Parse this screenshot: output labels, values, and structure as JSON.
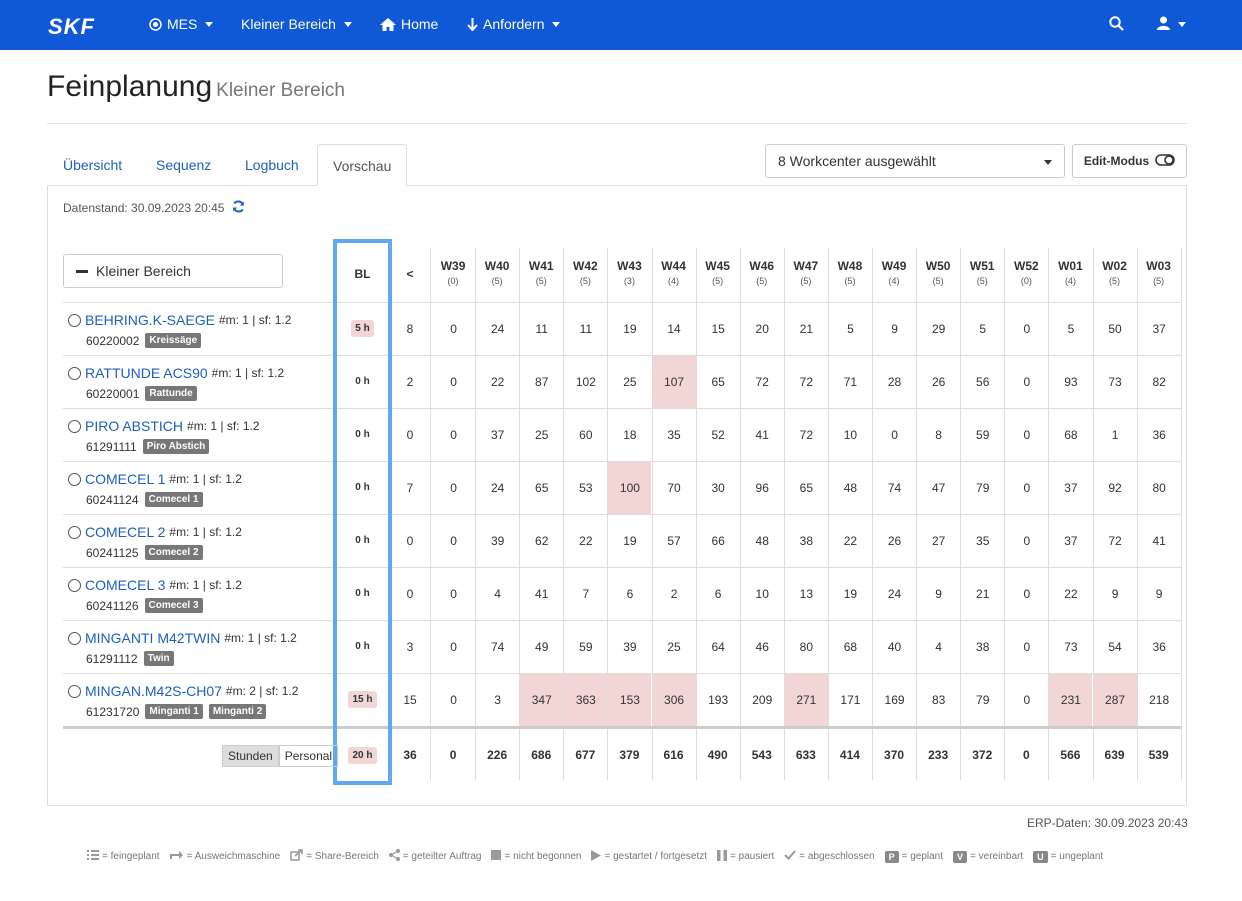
{
  "nav": {
    "logo": "SKF",
    "items": [
      {
        "label": "MES",
        "icon": "target-icon"
      },
      {
        "label": "Kleiner Bereich",
        "icon": ""
      },
      {
        "label": "Home",
        "icon": "home-icon"
      },
      {
        "label": "Anfordern",
        "icon": "arrow-down-icon"
      }
    ]
  },
  "page": {
    "title": "Feinplanung",
    "subtitle": "Kleiner Bereich"
  },
  "tabs": [
    "Übersicht",
    "Sequenz",
    "Logbuch",
    "Vorschau"
  ],
  "workcenter_select": "8 Workcenter ausgewählt",
  "edit_mode_label": "Edit-Modus",
  "datenstand": "Datenstand: 30.09.2023 20:45",
  "bereich_button": "Kleiner Bereich",
  "columns": {
    "bl": "BL",
    "lt": "<",
    "weeks": [
      {
        "w": "W39",
        "n": "(0)"
      },
      {
        "w": "W40",
        "n": "(5)"
      },
      {
        "w": "W41",
        "n": "(5)"
      },
      {
        "w": "W42",
        "n": "(5)"
      },
      {
        "w": "W43",
        "n": "(3)"
      },
      {
        "w": "W44",
        "n": "(4)"
      },
      {
        "w": "W45",
        "n": "(5)"
      },
      {
        "w": "W46",
        "n": "(5)"
      },
      {
        "w": "W47",
        "n": "(5)"
      },
      {
        "w": "W48",
        "n": "(5)"
      },
      {
        "w": "W49",
        "n": "(4)"
      },
      {
        "w": "W50",
        "n": "(5)"
      },
      {
        "w": "W51",
        "n": "(5)"
      },
      {
        "w": "W52",
        "n": "(0)"
      },
      {
        "w": "W01",
        "n": "(4)"
      },
      {
        "w": "W02",
        "n": "(5)"
      },
      {
        "w": "W03",
        "n": "(5)"
      }
    ]
  },
  "rows": [
    {
      "name": "BEHRING.K-SAEGE",
      "meta": "#m: 1 | sf: 1.2",
      "id": "60220002",
      "badges": [
        "Kreissäge"
      ],
      "bl": "5 h",
      "bl_red": true,
      "lt": "8",
      "values": [
        "0",
        "24",
        "11",
        "11",
        "19",
        "14",
        "15",
        "20",
        "21",
        "5",
        "9",
        "29",
        "5",
        "0",
        "5",
        "50",
        "37"
      ],
      "red": []
    },
    {
      "name": "RATTUNDE ACS90",
      "meta": "#m: 1 | sf: 1.2",
      "id": "60220001",
      "badges": [
        "Rattunde"
      ],
      "bl": "0 h",
      "bl_red": false,
      "lt": "2",
      "values": [
        "0",
        "22",
        "87",
        "102",
        "25",
        "107",
        "65",
        "72",
        "72",
        "71",
        "28",
        "26",
        "56",
        "0",
        "93",
        "73",
        "82"
      ],
      "red": [
        5
      ]
    },
    {
      "name": "PIRO ABSTICH",
      "meta": "#m: 1 | sf: 1.2",
      "id": "61291111",
      "badges": [
        "Piro Abstich"
      ],
      "bl": "0 h",
      "bl_red": false,
      "lt": "0",
      "values": [
        "0",
        "37",
        "25",
        "60",
        "18",
        "35",
        "52",
        "41",
        "72",
        "10",
        "0",
        "8",
        "59",
        "0",
        "68",
        "1",
        "36"
      ],
      "red": []
    },
    {
      "name": "COMECEL 1",
      "meta": "#m: 1 | sf: 1.2",
      "id": "60241124",
      "badges": [
        "Comecel 1"
      ],
      "bl": "0 h",
      "bl_red": false,
      "lt": "7",
      "values": [
        "0",
        "24",
        "65",
        "53",
        "100",
        "70",
        "30",
        "96",
        "65",
        "48",
        "74",
        "47",
        "79",
        "0",
        "37",
        "92",
        "80"
      ],
      "red": [
        4
      ]
    },
    {
      "name": "COMECEL 2",
      "meta": "#m: 1 | sf: 1.2",
      "id": "60241125",
      "badges": [
        "Comecel 2"
      ],
      "bl": "0 h",
      "bl_red": false,
      "lt": "0",
      "values": [
        "0",
        "39",
        "62",
        "22",
        "19",
        "57",
        "66",
        "48",
        "38",
        "22",
        "26",
        "27",
        "35",
        "0",
        "37",
        "72",
        "41"
      ],
      "red": []
    },
    {
      "name": "COMECEL 3",
      "meta": "#m: 1 | sf: 1.2",
      "id": "60241126",
      "badges": [
        "Comecel 3"
      ],
      "bl": "0 h",
      "bl_red": false,
      "lt": "0",
      "values": [
        "0",
        "4",
        "41",
        "7",
        "6",
        "2",
        "6",
        "10",
        "13",
        "19",
        "24",
        "9",
        "21",
        "0",
        "22",
        "9",
        "9"
      ],
      "red": []
    },
    {
      "name": "MINGANTI M42TWIN",
      "meta": "#m: 1 | sf: 1.2",
      "id": "61291112",
      "badges": [
        "Twin"
      ],
      "bl": "0 h",
      "bl_red": false,
      "lt": "3",
      "values": [
        "0",
        "74",
        "49",
        "59",
        "39",
        "25",
        "64",
        "46",
        "80",
        "68",
        "40",
        "4",
        "38",
        "0",
        "73",
        "54",
        "36"
      ],
      "red": []
    },
    {
      "name": "MINGAN.M42S-CH07",
      "meta": "#m: 2 | sf: 1.2",
      "id": "61231720",
      "badges": [
        "Minganti 1",
        "Minganti 2"
      ],
      "bl": "15 h",
      "bl_red": true,
      "lt": "15",
      "values": [
        "0",
        "3",
        "347",
        "363",
        "153",
        "306",
        "193",
        "209",
        "271",
        "171",
        "169",
        "83",
        "79",
        "0",
        "231",
        "287",
        "218"
      ],
      "red": [
        2,
        3,
        4,
        5,
        8,
        14,
        15
      ]
    }
  ],
  "totals": {
    "bl": "20 h",
    "lt": "36",
    "values": [
      "0",
      "226",
      "686",
      "677",
      "379",
      "616",
      "490",
      "543",
      "633",
      "414",
      "370",
      "233",
      "372",
      "0",
      "566",
      "639",
      "539"
    ]
  },
  "toggle": {
    "stunden": "Stunden",
    "personal": "Personal"
  },
  "erp": "ERP-Daten: 30.09.2023 20:43",
  "legend": [
    {
      "icon": "list-icon",
      "text": "= feingeplant"
    },
    {
      "icon": "reply-icon",
      "text": "= Ausweichmaschine"
    },
    {
      "icon": "share-box-icon",
      "text": "= Share-Bereich"
    },
    {
      "icon": "share-nodes-icon",
      "text": "= geteilter Auftrag"
    },
    {
      "icon": "stop-icon",
      "text": "= nicht begonnen"
    },
    {
      "icon": "play-icon",
      "text": "= gestartet / fortgesetzt"
    },
    {
      "icon": "pause-icon",
      "text": "= pausiert"
    },
    {
      "icon": "check-icon",
      "text": "= abgeschlossen"
    },
    {
      "icon": "p-badge-icon",
      "badge": "P",
      "text": "= geplant"
    },
    {
      "icon": "v-badge-icon",
      "badge": "V",
      "text": "= vereinbart"
    },
    {
      "icon": "u-badge-icon",
      "badge": "U",
      "text": "= ungeplant"
    }
  ],
  "colors": {
    "nav": "#0F58D6",
    "link": "#1e5fbf",
    "highlight": "#f2d6d6",
    "bl_frame": "#5ea9ef"
  }
}
